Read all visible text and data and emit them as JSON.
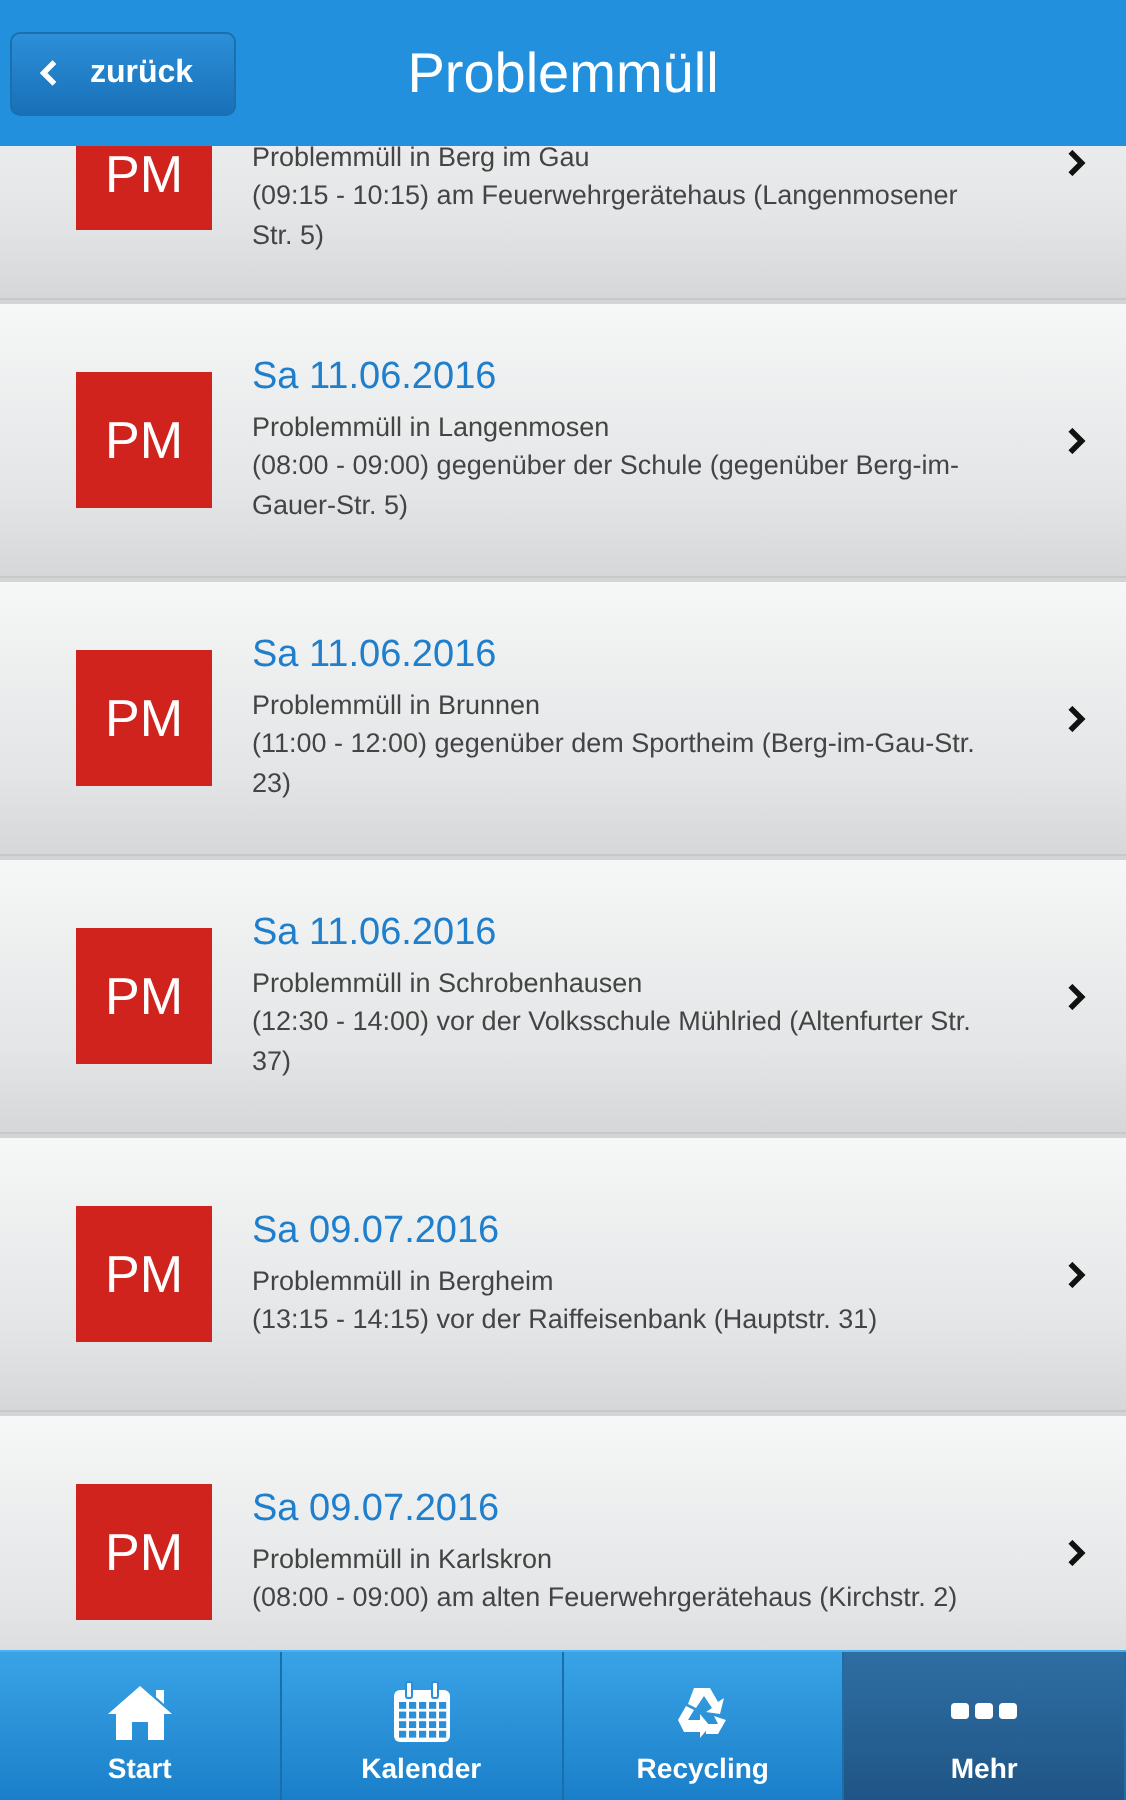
{
  "header": {
    "back_label": "zurück",
    "title": "Problemmüll"
  },
  "events": [
    {
      "badge": "PM",
      "place": "Problemmüll in Berg im Gau",
      "details": "(09:15 - 10:15) am Feuerwehrgerätehaus (Langenmosener Str. 5)"
    },
    {
      "badge": "PM",
      "date": "Sa 11.06.2016",
      "place": "Problemmüll in Langenmosen",
      "details": "(08:00 - 09:00) gegenüber der Schule (gegenüber Berg-im-Gauer-Str. 5)"
    },
    {
      "badge": "PM",
      "date": "Sa 11.06.2016",
      "place": "Problemmüll in Brunnen",
      "details": "(11:00 - 12:00) gegenüber dem Sportheim (Berg-im-Gau-Str. 23)"
    },
    {
      "badge": "PM",
      "date": "Sa 11.06.2016",
      "place": "Problemmüll in Schrobenhausen",
      "details": "(12:30 - 14:00) vor der Volksschule Mühlried (Altenfurter Str. 37)"
    },
    {
      "badge": "PM",
      "date": "Sa 09.07.2016",
      "place": "Problemmüll in Bergheim",
      "details": "(13:15 - 14:15) vor der Raiffeisenbank (Hauptstr. 31)"
    },
    {
      "badge": "PM",
      "date": "Sa 09.07.2016",
      "place": "Problemmüll in Karlskron",
      "details": "(08:00 - 09:00) am alten Feuerwehrgerätehaus (Kirchstr. 2)"
    }
  ],
  "tabs": [
    {
      "kind": "home",
      "label": "Start",
      "selected": false
    },
    {
      "kind": "calendar",
      "label": "Kalender",
      "selected": false
    },
    {
      "kind": "recycle",
      "label": "Recycling",
      "selected": false
    },
    {
      "kind": "more",
      "label": "Mehr",
      "selected": true
    }
  ]
}
